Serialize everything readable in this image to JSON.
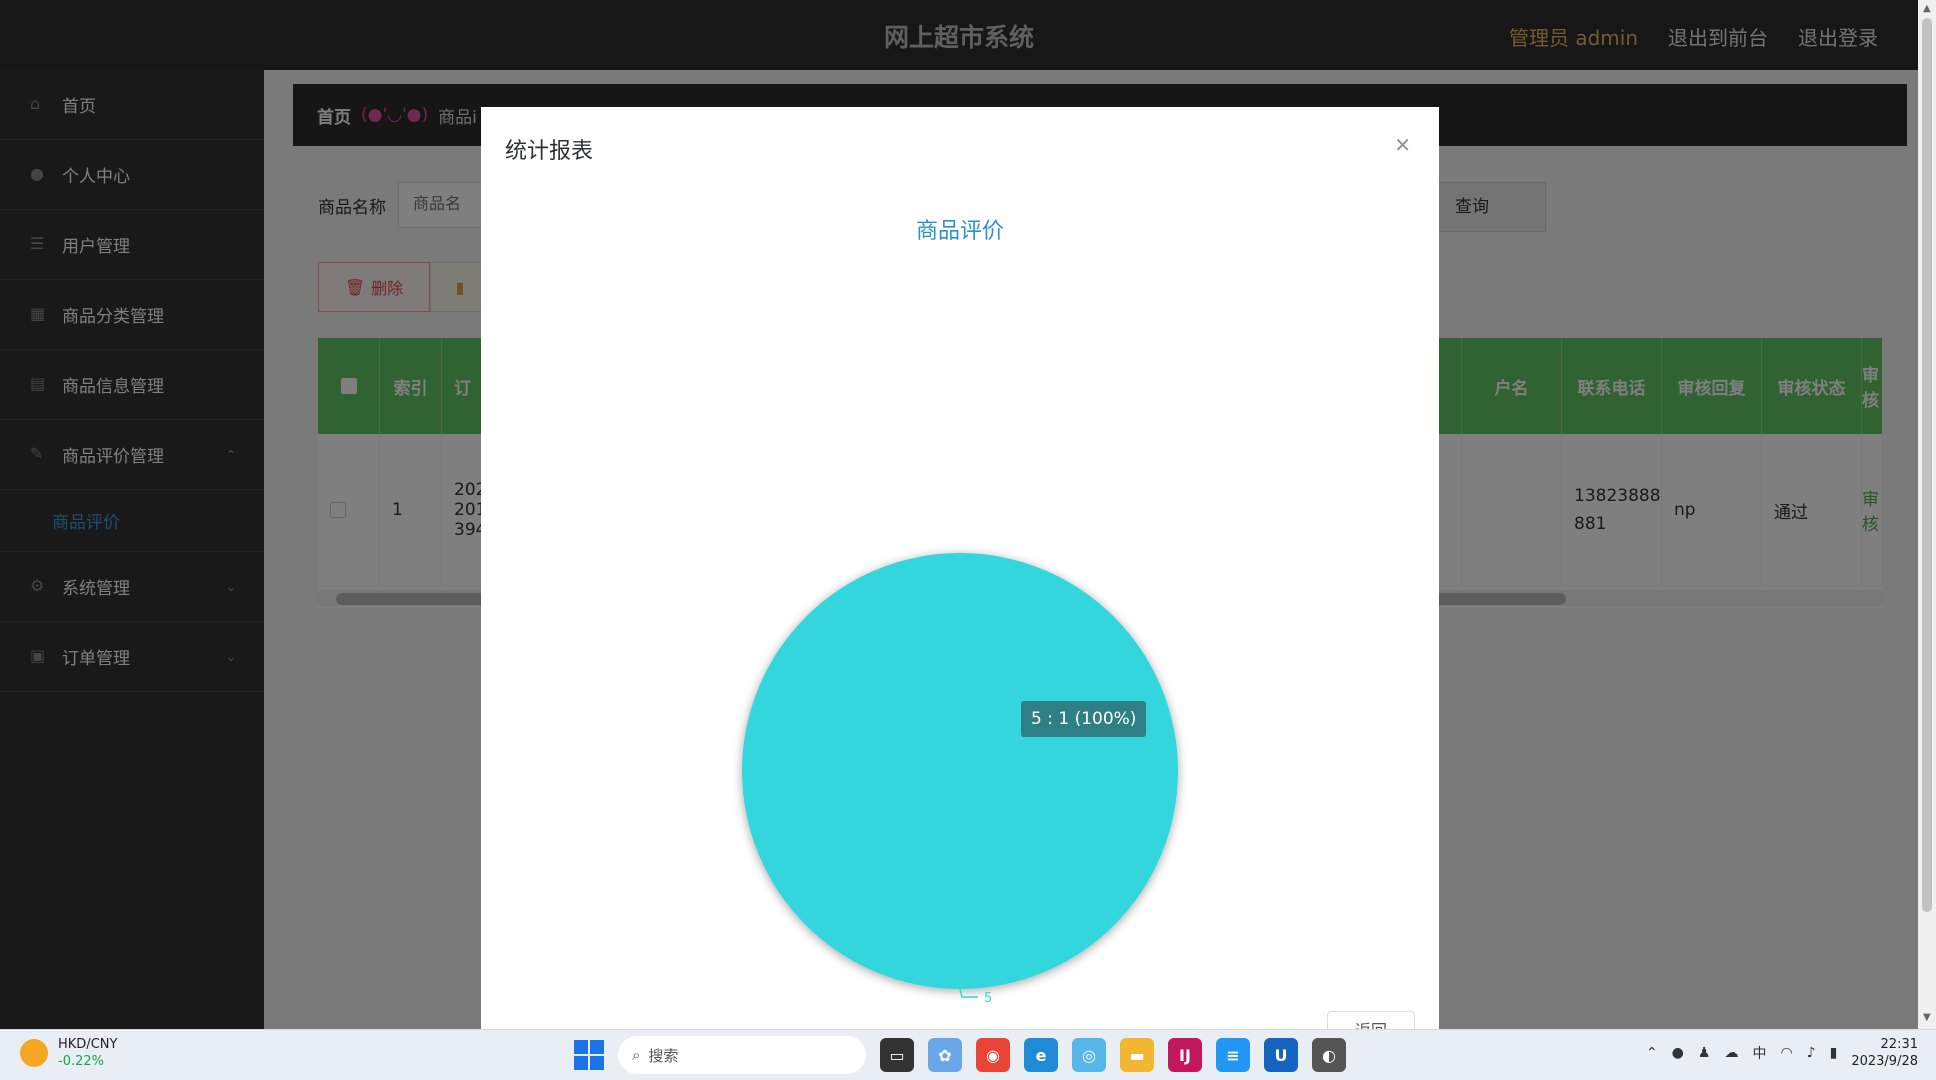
{
  "header": {
    "title": "网上超市系统",
    "admin_label": "管理员 admin",
    "to_front": "退出到前台",
    "logout": "退出登录"
  },
  "sidebar": {
    "items": [
      {
        "label": "首页",
        "icon": "home-icon"
      },
      {
        "label": "个人中心",
        "icon": "user-icon"
      },
      {
        "label": "用户管理",
        "icon": "users-icon"
      },
      {
        "label": "商品分类管理",
        "icon": "category-icon"
      },
      {
        "label": "商品信息管理",
        "icon": "goods-icon"
      },
      {
        "label": "商品评价管理",
        "icon": "review-icon"
      },
      {
        "label": "系统管理",
        "icon": "settings-icon"
      },
      {
        "label": "订单管理",
        "icon": "order-icon"
      }
    ],
    "sub_item": "商品评价"
  },
  "breadcrumb": {
    "home": "首页",
    "face": "(●'◡'●)",
    "current": "商品i"
  },
  "search": {
    "label": "商品名称",
    "placeholder": "商品名",
    "query_button": "查询"
  },
  "actions": {
    "delete_label": "删除"
  },
  "table": {
    "headers": [
      "索引",
      "订",
      "户名",
      "联系电话",
      "审核回复",
      "审核状态",
      "审核"
    ],
    "row": {
      "index": "1",
      "order": "202\n201\n394",
      "phone": "13823888881",
      "reply": "np",
      "status": "通过",
      "action": "审核"
    }
  },
  "modal": {
    "title": "统计报表",
    "chart_title": "商品评价",
    "footer_button": "返回"
  },
  "chart_data": {
    "type": "pie",
    "title": "商品评价",
    "slices": [
      {
        "label": "5",
        "value": 1,
        "percent": 100,
        "color": "#33d6dc"
      }
    ],
    "tooltip": "5 : 1 (100%)"
  },
  "taskbar": {
    "fx_name": "HKD/CNY",
    "fx_change": "-0.22%",
    "search_placeholder": "搜索",
    "time": "22:31",
    "date": "2023/9/28"
  }
}
